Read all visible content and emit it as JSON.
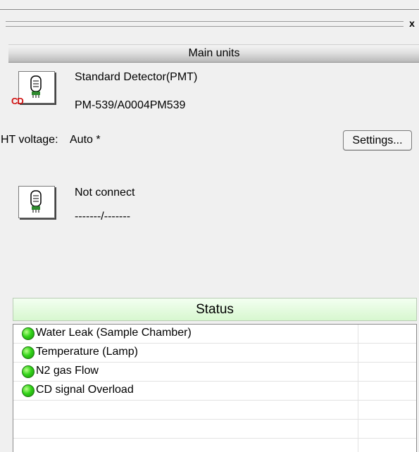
{
  "window": {
    "close_glyph": "x"
  },
  "main_units": {
    "header": "Main units",
    "detector1": {
      "name": "Standard Detector(PMT)",
      "model": "PM-539/A0004PM539",
      "icon": "pmt-detector-icon",
      "icon_badge": "CD"
    },
    "ht_voltage": {
      "label": "HT voltage:",
      "value": "Auto *"
    },
    "settings_button": "Settings...",
    "detector2": {
      "name": "Not connect",
      "model": "-------/-------",
      "icon": "pmt-detector-icon"
    }
  },
  "status": {
    "header": "Status",
    "ok_color": "#33d41a",
    "items": [
      {
        "label": "Water Leak (Sample Chamber)",
        "state": "ok"
      },
      {
        "label": "Temperature (Lamp)",
        "state": "ok"
      },
      {
        "label": "N2 gas Flow",
        "state": "ok"
      },
      {
        "label": "CD signal Overload",
        "state": "ok"
      }
    ]
  }
}
